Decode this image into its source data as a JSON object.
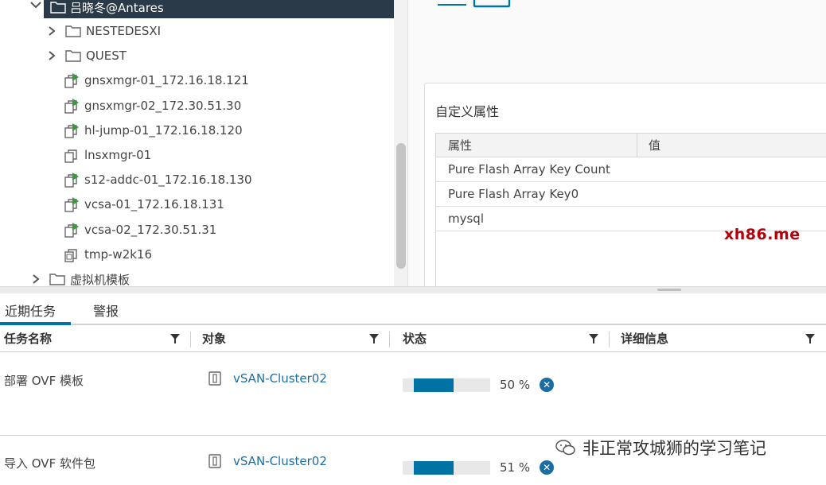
{
  "tree": {
    "root_label": "吕晓冬@Antares",
    "items": [
      {
        "label": "NESTEDESXI",
        "type": "folder",
        "expandable": true
      },
      {
        "label": "QUEST",
        "type": "folder",
        "expandable": true
      },
      {
        "label": "gnsxmgr-01_172.16.18.121",
        "type": "vm-on",
        "expandable": false
      },
      {
        "label": "gnsxmgr-02_172.30.51.30",
        "type": "vm-on",
        "expandable": false
      },
      {
        "label": "hl-jump-01_172.16.18.120",
        "type": "vm-on",
        "expandable": false
      },
      {
        "label": "lnsxmgr-01",
        "type": "vm-off",
        "expandable": false
      },
      {
        "label": "s12-addc-01_172.16.18.130",
        "type": "vm-on",
        "expandable": false
      },
      {
        "label": "vcsa-01_172.16.18.131",
        "type": "vm-on",
        "expandable": false
      },
      {
        "label": "vcsa-02_172.30.51.31",
        "type": "vm-on",
        "expandable": false
      },
      {
        "label": "tmp-w2k16",
        "type": "template",
        "expandable": false
      },
      {
        "label": "虚拟机模板",
        "type": "folder",
        "expandable": true
      }
    ]
  },
  "custom_attributes": {
    "title": "自定义属性",
    "col_attr": "属性",
    "col_value": "值",
    "rows": [
      "Pure Flash Array Key Count",
      "Pure Flash Array Key0",
      "mysql"
    ]
  },
  "watermark_site": "xh86.me",
  "tasks": {
    "tab_recent": "近期任务",
    "tab_alarms": "警报",
    "columns": [
      "任务名称",
      "对象",
      "状态",
      "详细信息"
    ],
    "rows": [
      {
        "name": "部署 OVF 模板",
        "object": "vSAN-Cluster02",
        "progress": 50,
        "progress_label": "50 %"
      },
      {
        "name": "导入 OVF 软件包",
        "object": "vSAN-Cluster02",
        "progress": 51,
        "progress_label": "51 %"
      }
    ]
  },
  "watermark_wechat": "非正常攻城狮的学习笔记",
  "colors": {
    "accent": "#0072a3",
    "link": "#1b6ea3",
    "selected_bg": "#2b3a48",
    "vm_on": "#3a9a3a",
    "watermark_red": "#b4000a"
  },
  "icons": {
    "folder": "folder-icon",
    "vm_on": "vm-powered-on-icon",
    "vm_off": "vm-powered-off-icon",
    "template": "vm-template-icon",
    "cluster": "cluster-icon",
    "filter": "filter-icon",
    "cancel": "cancel-icon",
    "wechat": "wechat-icon"
  }
}
